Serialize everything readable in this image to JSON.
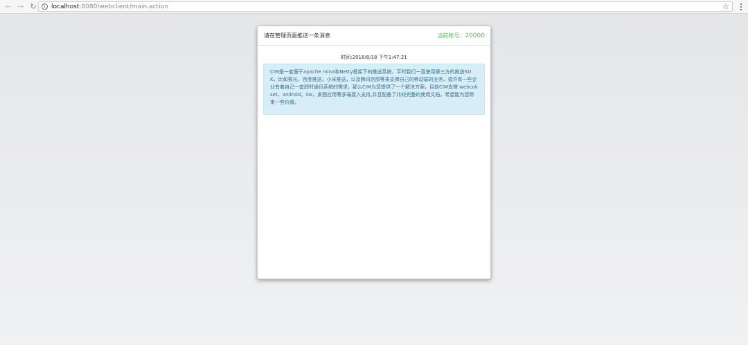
{
  "browser": {
    "url_host": "localhost",
    "url_path": ":8080/webclient/main.action"
  },
  "dialog": {
    "title": "请在管理页面推送一条消息",
    "account_label": "当前帐号：",
    "account_number": "20000",
    "message": {
      "time": "时间:2018/8/18 下午1:47:21",
      "text": "CIM是一套基于apache mina和Netty框架下的推送系统，平时我们一直使用第三方的推送SDK，比如极光，百度推送，小米推送，以及腾讯信鸽等来支撑自己的移动端的业务，或许有一些企业有着自己一套即时通讯系统的需求，那么CIM为您提供了一个解决方案，目前CIM支撑 webcokset，android，ios，桌面应用等多端接入支持,并且配备了比较完整的使用文档，希望能为您带来一些价值。"
    }
  },
  "colors": {
    "account": "#5cb85c",
    "bubble_bg": "#d9edf7",
    "bubble_text": "#31708f"
  }
}
